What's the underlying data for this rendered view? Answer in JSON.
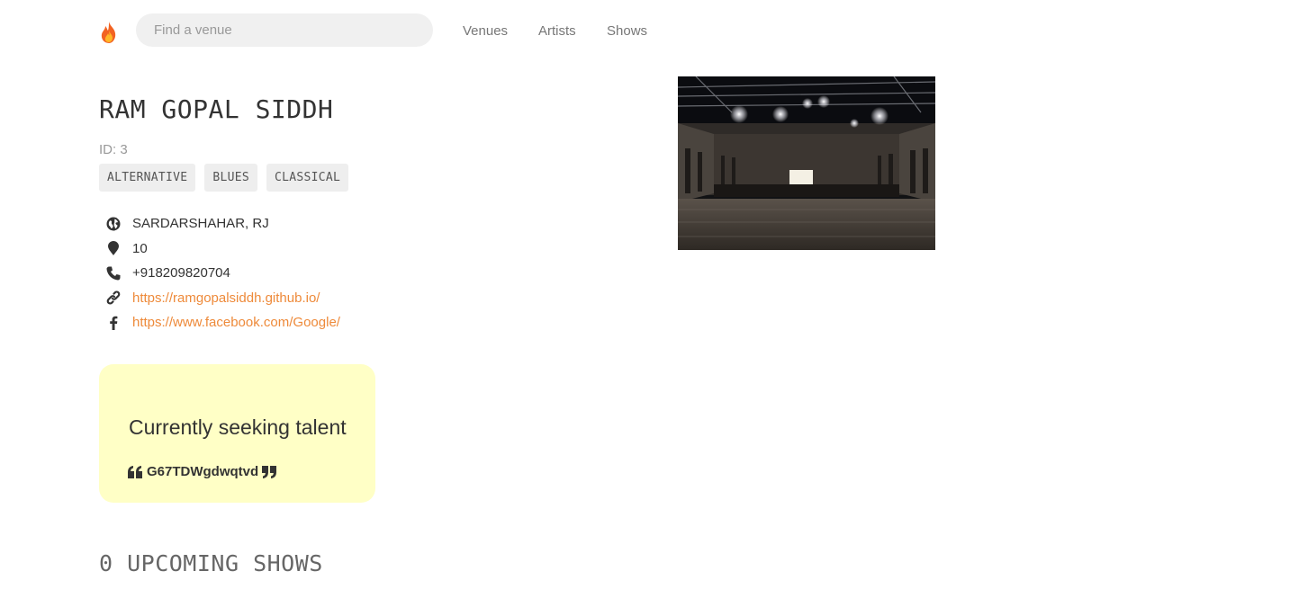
{
  "nav": {
    "logo_icon": "fire-icon",
    "search_placeholder": "Find a venue",
    "links": [
      "Venues",
      "Artists",
      "Shows"
    ]
  },
  "venue": {
    "name": "RAM GOPAL SIDDH",
    "id_text": "ID: 3",
    "genres": [
      "ALTERNATIVE",
      "BLUES",
      "CLASSICAL"
    ],
    "city_state": "SARDARSHAHAR, RJ",
    "address": "10",
    "phone": "+918209820704",
    "website": "https://ramgopalsiddh.github.io/",
    "facebook": "https://www.facebook.com/Google/"
  },
  "seeking": {
    "title": "Currently seeking talent",
    "description": "G67TDWgdwqtvd"
  },
  "upcoming_shows": {
    "heading": "0 UPCOMING SHOWS"
  },
  "colors": {
    "accent_link": "#ee8a3a",
    "seeking_bg": "#ffffc6",
    "tag_bg": "#eeeeee"
  }
}
